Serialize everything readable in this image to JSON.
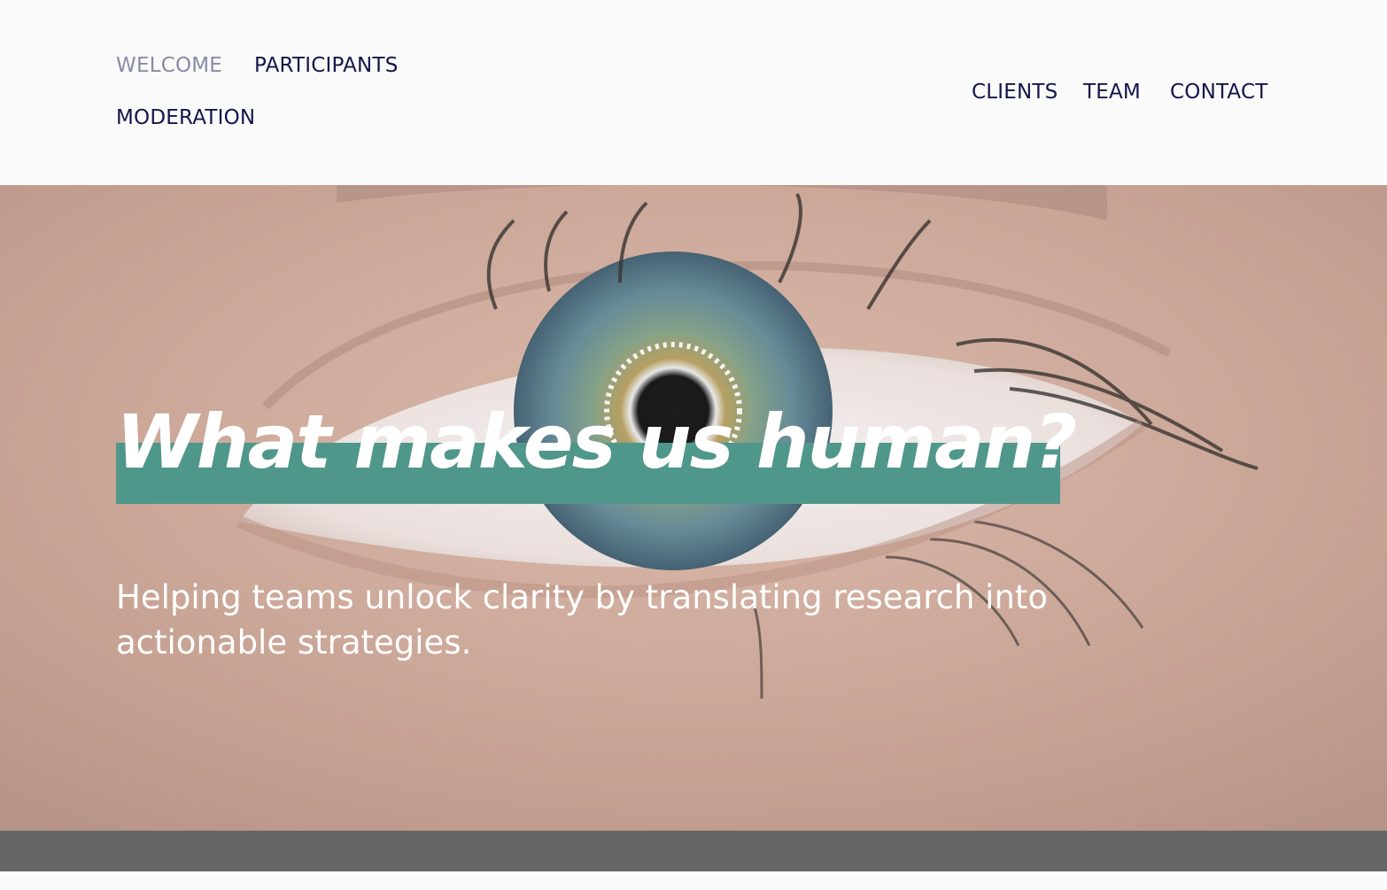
{
  "nav": {
    "left": [
      {
        "label": "WELCOME",
        "active": true
      },
      {
        "label": "PARTICIPANTS",
        "active": false
      },
      {
        "label": "MODERATION",
        "active": false
      }
    ],
    "right": [
      {
        "label": "CLIENTS"
      },
      {
        "label": "TEAM"
      },
      {
        "label": "CONTACT"
      }
    ]
  },
  "hero": {
    "title": "What makes us human?",
    "subtitle": "Helping teams unlock clarity by translating research into actionable strategies.",
    "image": "close-up of a human eye"
  },
  "colors": {
    "nav_text": "#13164a",
    "nav_active": "#8a8aa7",
    "title_highlight": "#4f978a",
    "bottom_band": "#666666"
  }
}
